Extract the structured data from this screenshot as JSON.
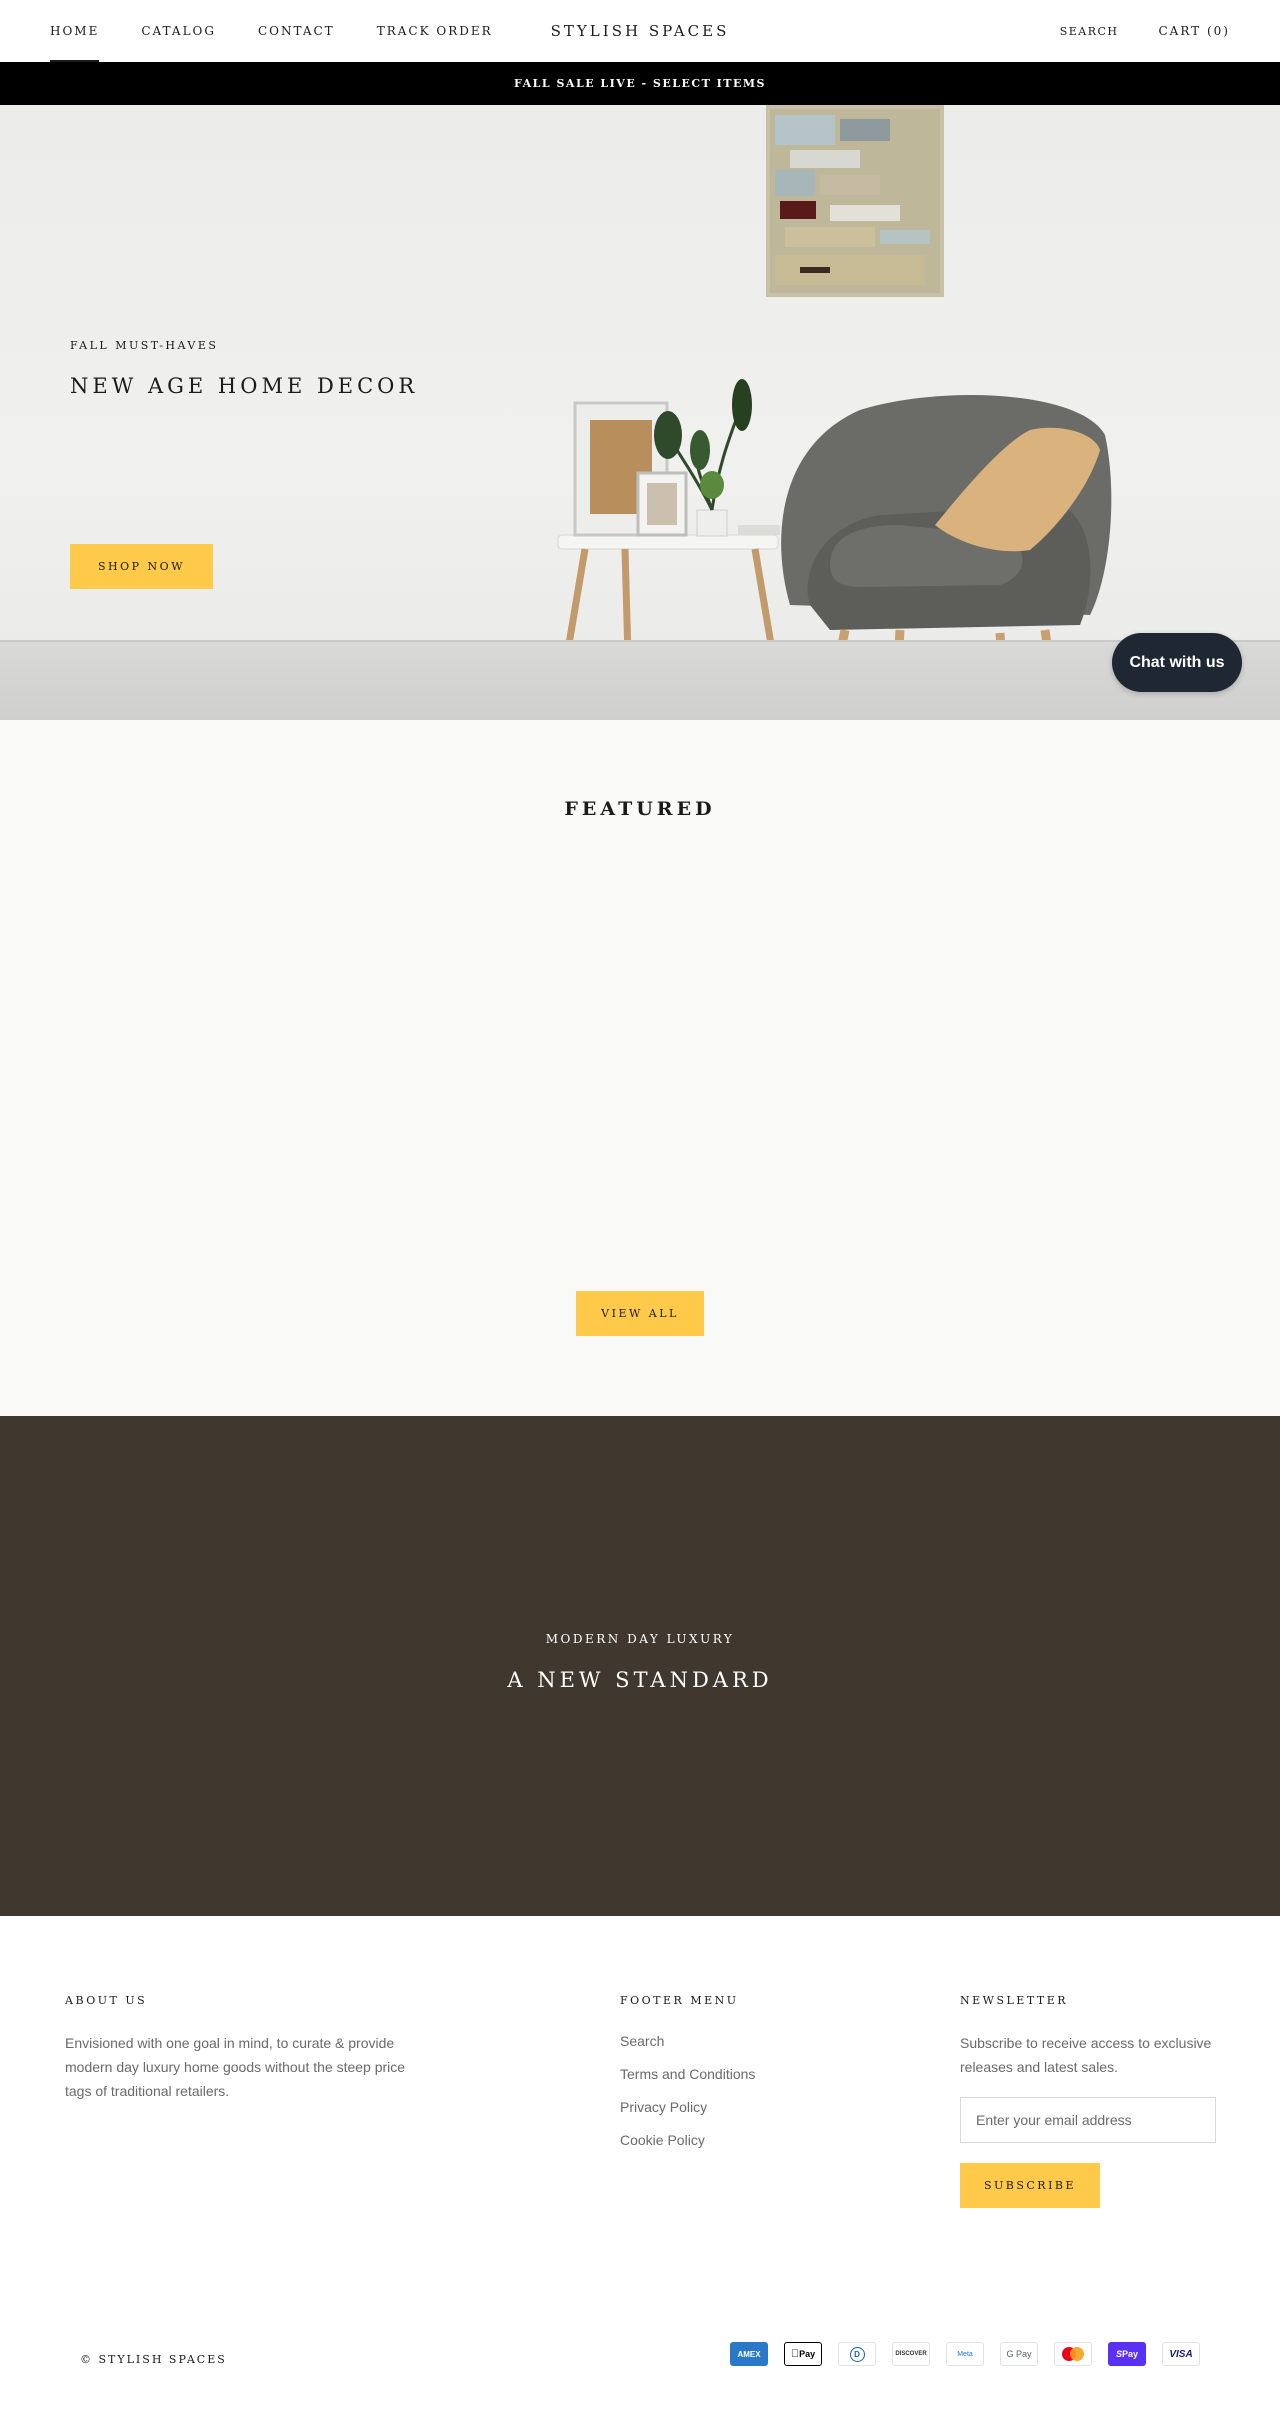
{
  "header": {
    "nav": [
      "HOME",
      "CATALOG",
      "CONTACT",
      "TRACK ORDER"
    ],
    "logo": "STYLISH SPACES",
    "search_label": "SEARCH",
    "cart_label": "CART (0)"
  },
  "announcement": "FALL SALE LIVE - SELECT ITEMS",
  "hero": {
    "kicker": "FALL MUST-HAVES",
    "title": "NEW AGE HOME DECOR",
    "button": "SHOP NOW"
  },
  "chat": {
    "label": "Chat with us"
  },
  "featured": {
    "title": "FEATURED",
    "button": "VIEW ALL"
  },
  "banner": {
    "kicker": "MODERN DAY LUXURY",
    "title": "A NEW STANDARD"
  },
  "footer": {
    "about": {
      "heading": "ABOUT US",
      "text": "Envisioned with one goal in mind, to curate & provide modern day luxury home goods without the steep price tags of traditional retailers."
    },
    "menu": {
      "heading": "FOOTER MENU",
      "items": [
        "Search",
        "Terms and Conditions",
        "Privacy Policy",
        "Cookie Policy"
      ]
    },
    "newsletter": {
      "heading": "NEWSLETTER",
      "text": "Subscribe to receive access to exclusive releases and latest sales.",
      "placeholder": "Enter your email address",
      "button": "SUBSCRIBE"
    },
    "copyright": "© STYLISH SPACES",
    "payments": [
      "AMEX",
      "Pay",
      "D",
      "DISCOVER",
      "Meta",
      "G Pay",
      "",
      "Pay",
      "VISA"
    ]
  },
  "colors": {
    "accent": "#ffc94a",
    "announcement_bg": "#000000",
    "banner_bg": "#40372e",
    "chat_bg": "#1f2733"
  },
  "icons": [
    "amex-icon",
    "apple-pay-icon",
    "diners-club-icon",
    "discover-icon",
    "meta-pay-icon",
    "google-pay-icon",
    "mastercard-icon",
    "shop-pay-icon",
    "visa-icon"
  ]
}
